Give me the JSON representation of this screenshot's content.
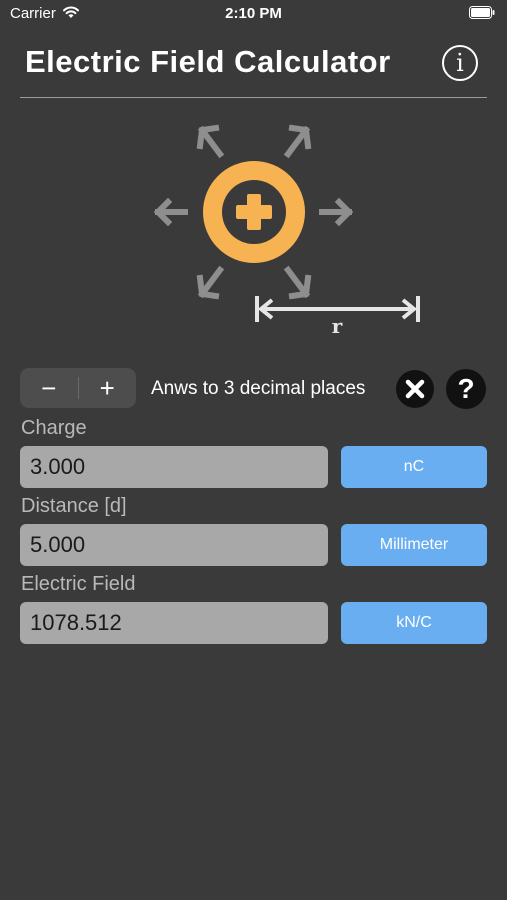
{
  "status_bar": {
    "carrier": "Carrier",
    "time": "2:10 PM",
    "wifi_icon": "wifi-icon",
    "battery_icon": "battery-icon"
  },
  "header": {
    "title": "Electric Field Calculator",
    "info_icon": "info-icon",
    "info_glyph": "i"
  },
  "diagram": {
    "charge_sign": "+",
    "distance_label": "r",
    "charge_color": "#f7b352",
    "arrow_color": "#8e8e8e",
    "line_color": "#e6e6e6"
  },
  "precision": {
    "decrement_label": "−",
    "increment_label": "+",
    "text": "Anws to 3 decimal places",
    "clear_icon": "close-icon",
    "help_label": "?"
  },
  "fields": [
    {
      "label": "Charge",
      "value": "3.000",
      "unit": "nC"
    },
    {
      "label": "Distance [d]",
      "value": "5.000",
      "unit": "Millimeter"
    },
    {
      "label": "Electric Field",
      "value": "1078.512",
      "unit": "kN/C"
    }
  ],
  "colors": {
    "background": "#3a3a3a",
    "input_background": "#a8a8a8",
    "unit_button": "#6aaef2",
    "label_text": "#b9b9b9"
  }
}
